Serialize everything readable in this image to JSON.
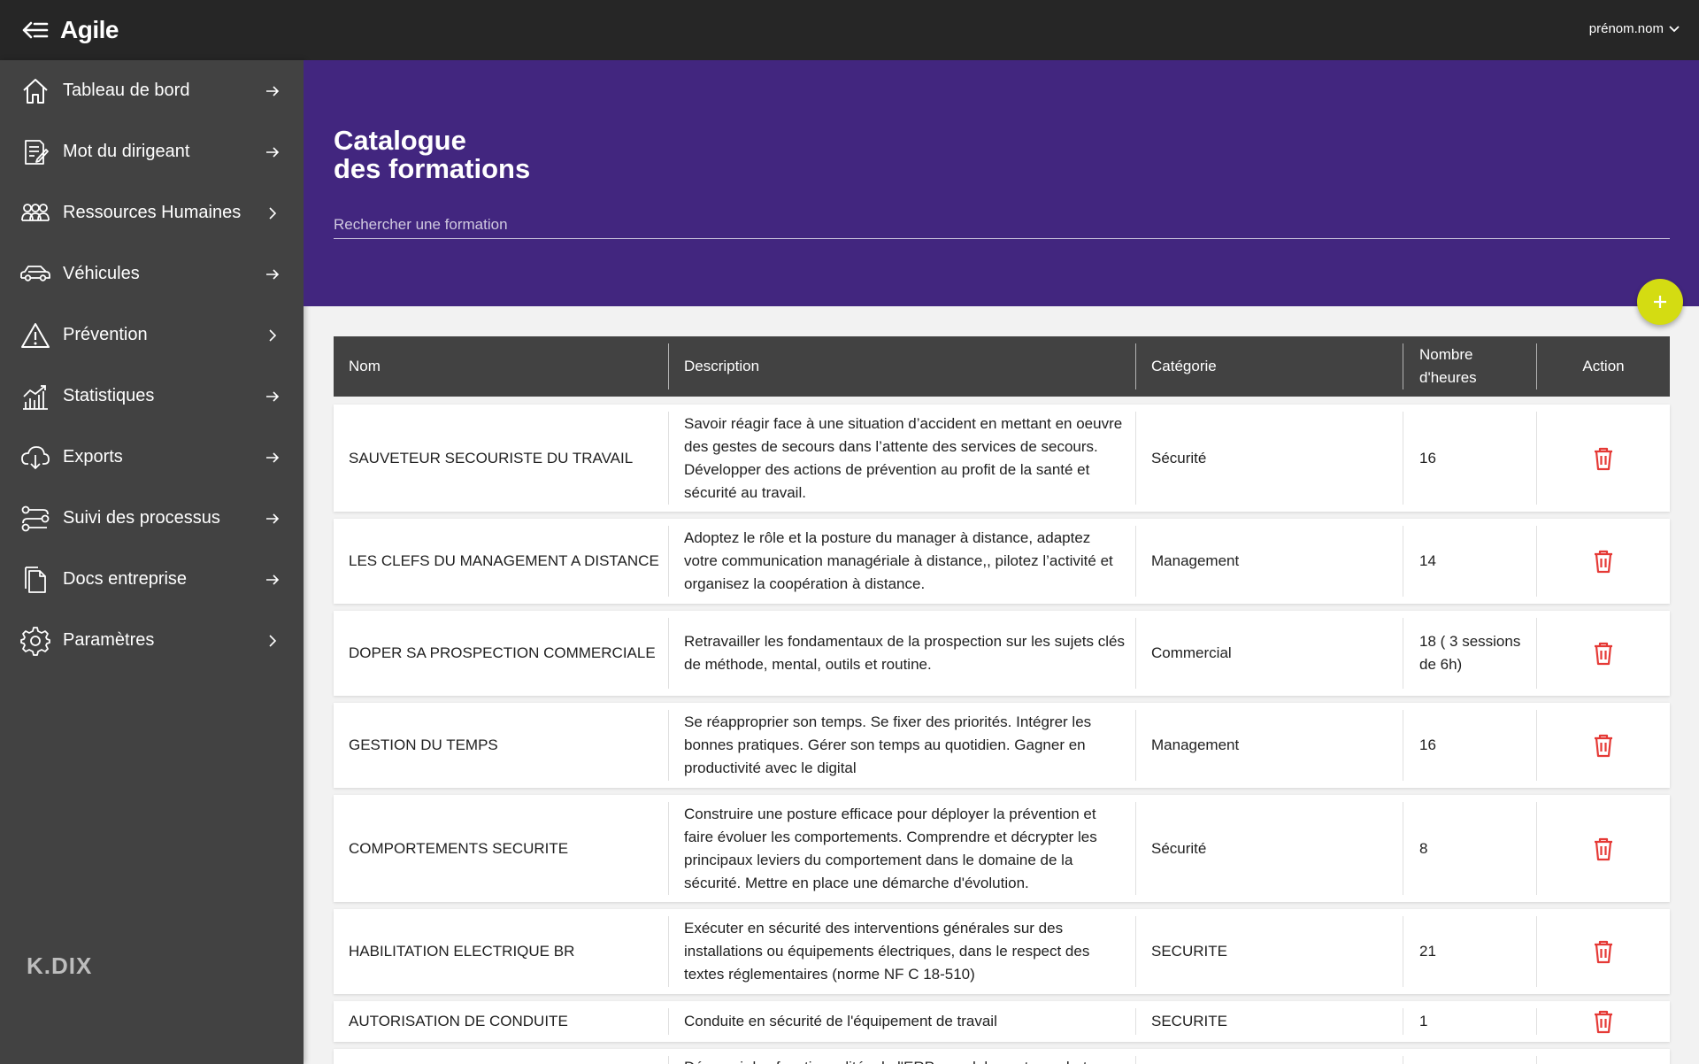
{
  "topbar": {
    "title": "Agile",
    "menu_icon": "back-menu-icon",
    "user_label": "prénom.nom"
  },
  "sidebar": {
    "items": [
      {
        "label": "Tableau de bord",
        "icon": "home-icon",
        "arrow": "arrow-right"
      },
      {
        "label": "Mot du dirigeant",
        "icon": "document-edit-icon",
        "arrow": "arrow-right"
      },
      {
        "label": "Ressources Humaines",
        "icon": "people-group-icon",
        "arrow": "chevron-right"
      },
      {
        "label": "Véhicules",
        "icon": "car-icon",
        "arrow": "arrow-right"
      },
      {
        "label": "Prévention",
        "icon": "warning-icon",
        "arrow": "chevron-right"
      },
      {
        "label": "Statistiques",
        "icon": "chart-icon",
        "arrow": "arrow-right"
      },
      {
        "label": "Exports",
        "icon": "download-icon",
        "arrow": "arrow-right"
      },
      {
        "label": "Suivi des processus",
        "icon": "process-icon",
        "arrow": "arrow-right"
      },
      {
        "label": "Docs entreprise",
        "icon": "file-icon",
        "arrow": "arrow-right"
      },
      {
        "label": "Paramètres",
        "icon": "gear-icon",
        "arrow": "chevron-right"
      }
    ],
    "brand": "K.DIX"
  },
  "header": {
    "title_line1": "Catalogue",
    "title_line2": "des formations",
    "search_placeholder": "Rechercher une formation"
  },
  "table": {
    "headers": {
      "nom": "Nom",
      "description": "Description",
      "categorie": "Catégorie",
      "heures_line1": "Nombre",
      "heures_line2": "d'heures",
      "action": "Action"
    },
    "rows": [
      {
        "nom": "SAUVETEUR SECOURISTE DU TRAVAIL",
        "description": "Savoir réagir face à une situation d’accident en mettant en oeuvre des gestes de secours dans l’attente des services de secours. Développer des actions de prévention au profit de la santé et sécurité au travail.",
        "categorie": "Sécurité",
        "heures": "16"
      },
      {
        "nom": "LES CLEFS DU MANAGEMENT A DISTANCE",
        "description": "Adoptez le rôle et la posture du manager à distance, adaptez votre communication managériale à distance,, pilotez l’activité et organisez la coopération à distance.",
        "categorie": "Management",
        "heures": "14"
      },
      {
        "nom": "DOPER SA PROSPECTION COMMERCIALE",
        "description": "Retravailler les fondamentaux de la prospection sur les sujets clés de méthode, mental, outils et routine.",
        "categorie": "Commercial",
        "heures": "18 ( 3 sessions de 6h)"
      },
      {
        "nom": "GESTION DU TEMPS",
        "description": "Se réapproprier son temps. Se fixer des priorités. Intégrer les bonnes pratiques. Gérer son temps au quotidien. Gagner en productivité avec le digital",
        "categorie": "Management",
        "heures": "16"
      },
      {
        "nom": "COMPORTEMENTS SECURITE",
        "description": "Construire une posture efficace pour déployer la prévention et faire évoluer les comportements. Comprendre et décrypter les principaux leviers du comportement dans le domaine de la sécurité. Mettre en place une démarche d'évolution.",
        "categorie": "Sécurité",
        "heures": "8"
      },
      {
        "nom": "HABILITATION ELECTRIQUE BR",
        "description": "Exécuter en sécurité des interventions générales sur des installations ou équipements électriques, dans le respect des textes réglementaires (norme NF C 18-510)",
        "categorie": "SECURITE",
        "heures": "21"
      },
      {
        "nom": "AUTORISATION DE CONDUITE",
        "description": "Conduite en sécurité de l'équipement de travail",
        "categorie": "SECURITE",
        "heures": "1"
      },
      {
        "nom": "",
        "description": "Découvrir les fonctionnalités de l'ERP : module vente - achat",
        "categorie": "",
        "heures": ""
      }
    ]
  },
  "colors": {
    "topbar": "#262626",
    "sidebar": "#424242",
    "header": "#42267f",
    "fab": "#d4dc12",
    "delete": "#e53935"
  }
}
